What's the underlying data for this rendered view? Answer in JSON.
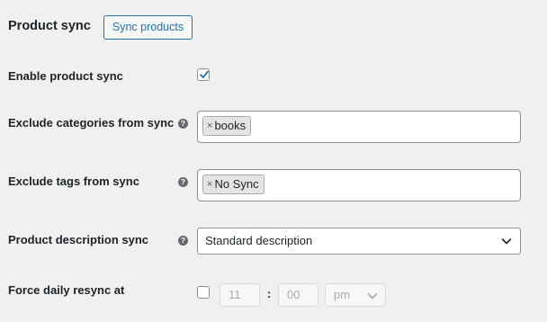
{
  "section": {
    "title": "Product sync",
    "sync_button_label": "Sync products"
  },
  "enable_sync": {
    "label": "Enable product sync",
    "checked": true
  },
  "exclude_categories": {
    "label": "Exclude categories from sync",
    "help_icon": "question-circle-icon",
    "tags": [
      "books"
    ]
  },
  "exclude_tags": {
    "label": "Exclude tags from sync",
    "help_icon": "question-circle-icon",
    "tags": [
      "No Sync"
    ]
  },
  "description_sync": {
    "label": "Product description sync",
    "help_icon": "question-circle-icon",
    "selected": "Standard description"
  },
  "daily_resync": {
    "label": "Force daily resync at",
    "checked": false,
    "hour": "11",
    "separator": ":",
    "minute": "00",
    "period": "pm"
  },
  "colors": {
    "background": "#f0f0f1",
    "accent": "#2271b1",
    "text": "#1d2327"
  }
}
